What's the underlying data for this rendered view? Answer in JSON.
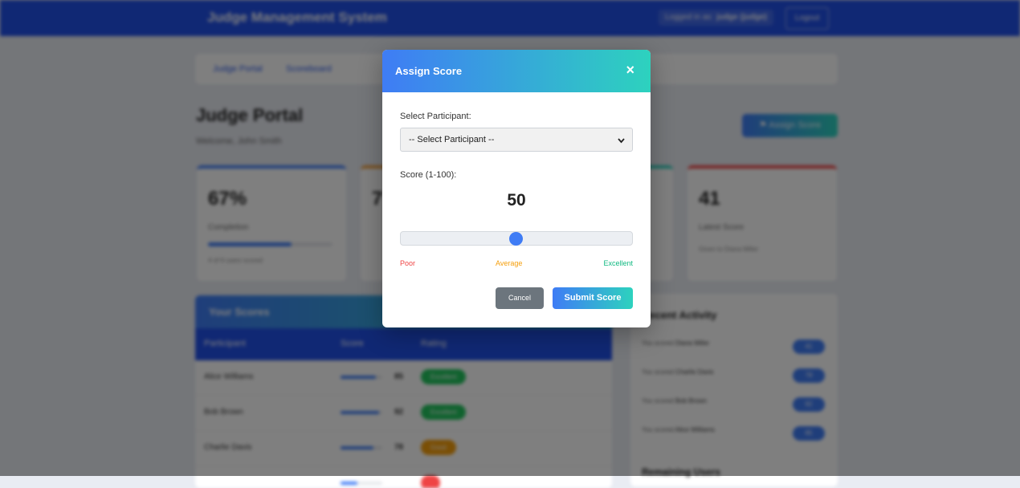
{
  "header": {
    "brand": "Judge Management System",
    "logged_in_prefix": "Logged in as:",
    "username": "judge (judge)",
    "logout_label": "Logout"
  },
  "nav": {
    "items": [
      "Judge Portal",
      "Scoreboard"
    ]
  },
  "page": {
    "title": "Judge Portal",
    "welcome": "Welcome, John Smith",
    "assign_button": "Assign Score"
  },
  "stats": [
    {
      "value": "67%",
      "label": "Completion",
      "sub": "4 of 6 users scored",
      "progress": 0.67,
      "color": "#3f7cf5"
    },
    {
      "value": "7",
      "label": "",
      "sub": "",
      "color": "#f2a03d"
    },
    {
      "value": "",
      "label": "",
      "sub": "",
      "color": "#2dd2be"
    },
    {
      "value": "41",
      "label": "Latest Score",
      "sub": "Given to Diana Miller",
      "color": "#ef4444"
    }
  ],
  "scores_card": {
    "title": "Your Scores",
    "columns": [
      "Participant",
      "Score",
      "Rating"
    ],
    "rows": [
      {
        "name": "Alice Williams",
        "score": "85",
        "rating": "Excellent",
        "fill": 0.85,
        "badge_color": "#22c55e"
      },
      {
        "name": "Bob Brown",
        "score": "92",
        "rating": "Excellent",
        "fill": 0.92,
        "badge_color": "#22c55e"
      },
      {
        "name": "Charlie Davis",
        "score": "78",
        "rating": "Good",
        "fill": 0.78,
        "badge_color": "#f59e0b"
      },
      {
        "name": "",
        "score": "",
        "rating": "",
        "fill": 0.41,
        "badge_color": "#ef4444"
      }
    ]
  },
  "activity": {
    "title": "Recent Activity",
    "prefix": "You scored",
    "items": [
      {
        "name": "Diana Miller",
        "score": "41"
      },
      {
        "name": "Charlie Davis",
        "score": "78"
      },
      {
        "name": "Bob Brown",
        "score": "92"
      },
      {
        "name": "Alice Williams",
        "score": "85"
      }
    ],
    "remaining_title": "Remaining Users"
  },
  "modal": {
    "title": "Assign Score",
    "close_symbol": "×",
    "participant_label": "Select Participant:",
    "participant_selected": "-- Select Participant --",
    "score_label": "Score (1-100):",
    "score_value": "50",
    "slider": {
      "min": 1,
      "max": 100,
      "value": 50
    },
    "scale": {
      "poor": "Poor",
      "average": "Average",
      "excellent": "Excellent"
    },
    "cancel_label": "Cancel",
    "submit_label": "Submit Score"
  },
  "colors": {
    "primary": "#2150e8",
    "accent_start": "#3f7cf5",
    "accent_end": "#2dd2be",
    "poor": "#ef4444",
    "average": "#f59e0b",
    "excellent": "#10b981"
  }
}
